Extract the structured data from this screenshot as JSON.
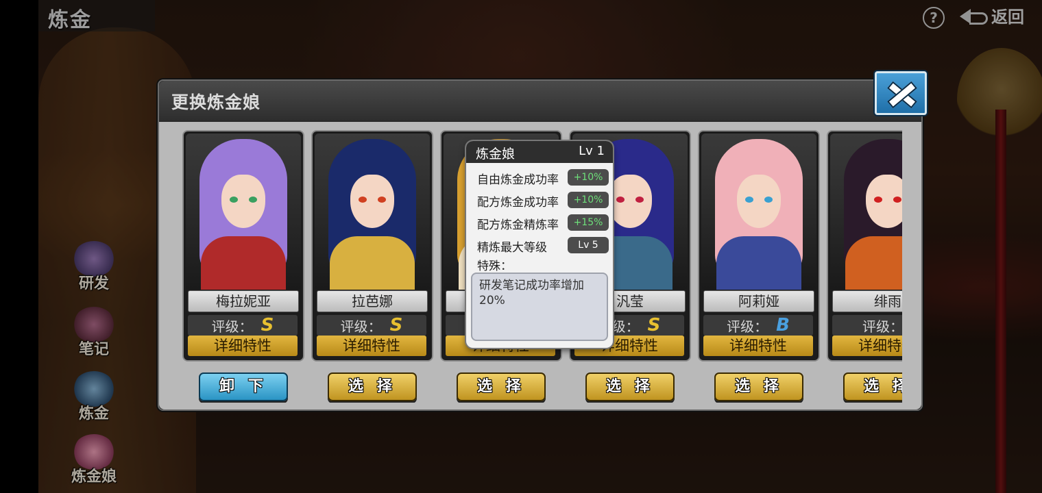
{
  "screen": {
    "title": "炼金",
    "back_label": "返回",
    "help_label": "?"
  },
  "sidenav": [
    {
      "id": "research",
      "label": "研发"
    },
    {
      "id": "notes",
      "label": "笔记"
    },
    {
      "id": "alchemy",
      "label": "炼金"
    },
    {
      "id": "alchemist-girl",
      "label": "炼金娘"
    }
  ],
  "dialog": {
    "title": "更换炼金娘",
    "rating_label": "评级：",
    "detail_label": "详细特性",
    "cards": [
      {
        "name": "梅拉妮亚",
        "rating": "S",
        "rating_color": "#e8c030",
        "action": "卸 下",
        "action_style": "blue",
        "hair": "#9a7ad8",
        "outfit": "#b02a2a",
        "eye": "#3aa060"
      },
      {
        "name": "拉芭娜",
        "rating": "S",
        "rating_color": "#e8c030",
        "action": "选 择",
        "action_style": "gold",
        "hair": "#1a2a6a",
        "outfit": "#d8b040",
        "eye": "#d04020"
      },
      {
        "name": "",
        "rating": "",
        "rating_color": "#e8c030",
        "action": "选 择",
        "action_style": "gold",
        "hair": "#d8a030",
        "outfit": "#f0e0c0",
        "eye": "#805020"
      },
      {
        "name": "汎莹",
        "rating": "S",
        "rating_color": "#e8c030",
        "action": "选 择",
        "action_style": "gold",
        "hair": "#2a2a8a",
        "outfit": "#3a6a8a",
        "eye": "#c02040"
      },
      {
        "name": "阿莉娅",
        "rating": "B",
        "rating_color": "#4aa0e0",
        "action": "选 择",
        "action_style": "gold",
        "hair": "#f0b0b8",
        "outfit": "#3a4a9a",
        "eye": "#3aa0d0"
      },
      {
        "name": "绯雨",
        "rating": "",
        "rating_color": "#e8c030",
        "action": "选 择",
        "action_style": "gold",
        "hair": "#2a1a2a",
        "outfit": "#d06020",
        "eye": "#d02020"
      }
    ]
  },
  "tooltip": {
    "title": "炼金娘",
    "level": "Lv 1",
    "stats": [
      {
        "label": "自由炼金成功率",
        "value": "+10%"
      },
      {
        "label": "配方炼金成功率",
        "value": "+10%"
      },
      {
        "label": "配方炼金精炼率",
        "value": "+15%"
      },
      {
        "label": "精炼最大等级",
        "value": "Lv 5"
      }
    ],
    "special_label": "特殊：",
    "special_text": "研发笔记成功率增加20%"
  }
}
